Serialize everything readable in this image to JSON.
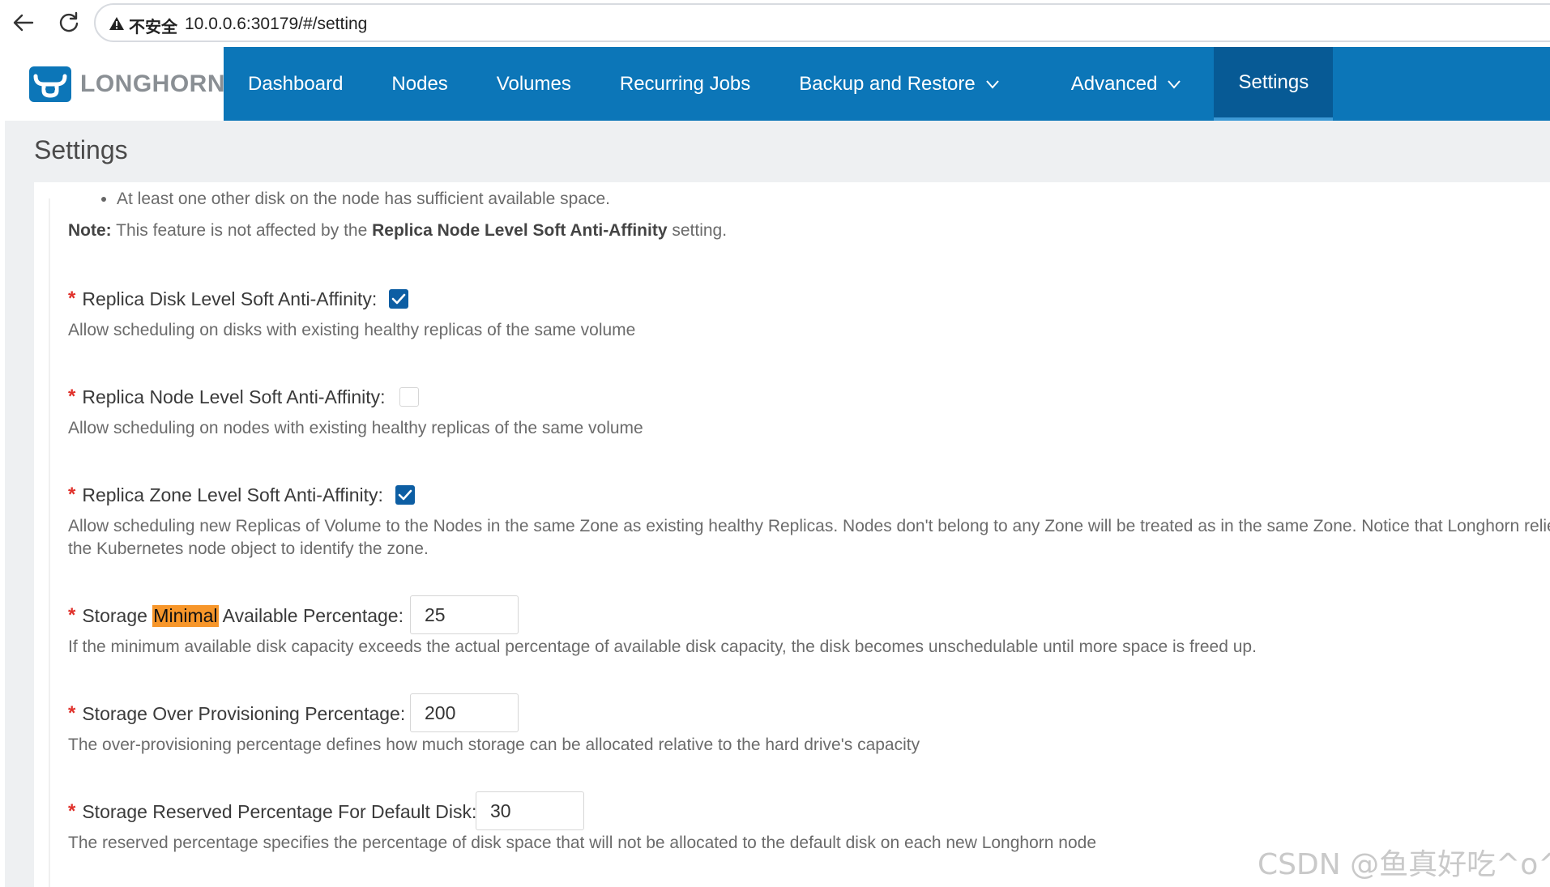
{
  "browser": {
    "insecure_label": "不安全",
    "url": "10.0.0.6:30179/#/setting"
  },
  "app": {
    "brand": "LONGHORN",
    "nav": [
      {
        "label": "Dashboard"
      },
      {
        "label": "Nodes"
      },
      {
        "label": "Volumes"
      },
      {
        "label": "Recurring Jobs"
      },
      {
        "label": "Backup and Restore",
        "dropdown": true
      },
      {
        "label": "Advanced",
        "dropdown": true
      },
      {
        "label": "Settings",
        "active": true
      }
    ],
    "colors": {
      "header": "#0c76b8",
      "active_tab": "#075a95",
      "required": "#e0312b",
      "highlight": "#f7962a"
    }
  },
  "page": {
    "title": "Settings",
    "intro": {
      "bullet": "At least one other disk on the node has sufficient available space.",
      "note_label": "Note:",
      "note_text_1": " This feature is not affected by the ",
      "note_bold": "Replica Node Level Soft Anti-Affinity",
      "note_text_2": " setting."
    },
    "settings": [
      {
        "label": "Replica Disk Level Soft Anti-Affinity:",
        "control": "checkbox",
        "checked": true,
        "description": "Allow scheduling on disks with existing healthy replicas of the same volume"
      },
      {
        "label": "Replica Node Level Soft Anti-Affinity:",
        "control": "checkbox",
        "checked": false,
        "description": "Allow scheduling on nodes with existing healthy replicas of the same volume"
      },
      {
        "label": "Replica Zone Level Soft Anti-Affinity:",
        "control": "checkbox",
        "checked": true,
        "description_line1": "Allow scheduling new Replicas of Volume to the Nodes in the same Zone as existing healthy Replicas. Nodes don't belong to any Zone will be treated as in the same Zone. Notice that Longhorn relies on",
        "description_line2": "the Kubernetes node object to identify the zone."
      },
      {
        "label_pre": "Storage ",
        "label_highlight": "Minimal",
        "label_post": " Available Percentage:",
        "control": "number",
        "value": "25",
        "description": "If the minimum available disk capacity exceeds the actual percentage of available disk capacity, the disk becomes unschedulable until more space is freed up."
      },
      {
        "label": "Storage Over Provisioning Percentage:",
        "control": "number",
        "value": "200",
        "description": "The over-provisioning percentage defines how much storage can be allocated relative to the hard drive's capacity"
      },
      {
        "label": "Storage Reserved Percentage For Default Disk:",
        "control": "number",
        "value": "30",
        "description": "The reserved percentage specifies the percentage of disk space that will not be allocated to the default disk on each new Longhorn node"
      }
    ],
    "required_mark": "*"
  },
  "watermark": "CSDN @鱼真好吃^o^"
}
